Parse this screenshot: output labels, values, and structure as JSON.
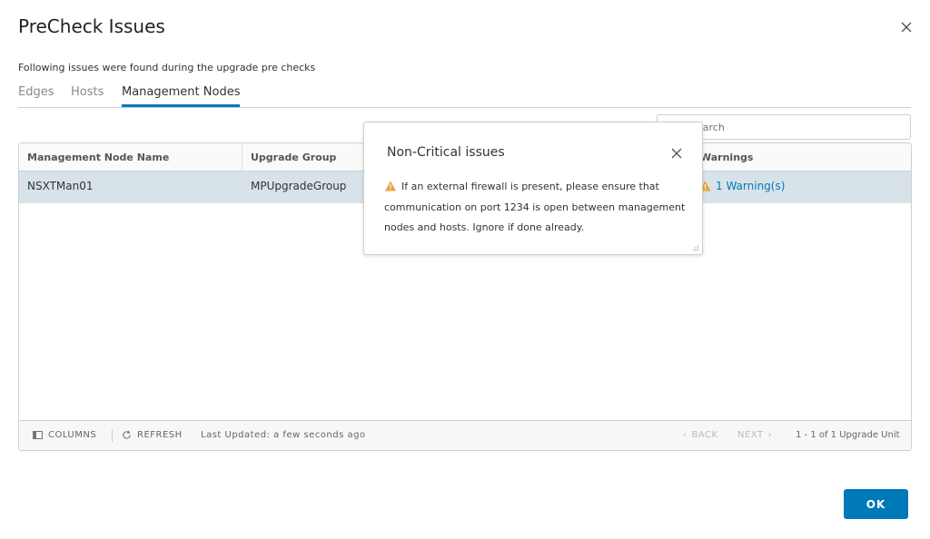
{
  "dialog": {
    "title": "PreCheck Issues",
    "subtitle": "Following issues were found during the upgrade pre checks",
    "ok_label": "OK"
  },
  "tabs": [
    {
      "label": "Edges",
      "active": false
    },
    {
      "label": "Hosts",
      "active": false
    },
    {
      "label": "Management Nodes",
      "active": true
    }
  ],
  "search": {
    "placeholder": "Search",
    "visible_fragment": "ch"
  },
  "grid": {
    "columns": [
      "Management Node Name",
      "Upgrade Group",
      "Warnings"
    ],
    "rows": [
      {
        "name": "NSXTMan01",
        "group": "MPUpgradeGroup",
        "warnings": "1 Warning(s)"
      }
    ],
    "footer": {
      "columns_label": "COLUMNS",
      "refresh_label": "REFRESH",
      "last_updated": "Last Updated: a few seconds ago",
      "back_label": "BACK",
      "next_label": "NEXT",
      "pagination": "1 - 1 of 1 Upgrade Unit"
    }
  },
  "popover": {
    "title": "Non-Critical issues",
    "message": "If an external firewall is present, please ensure that communication on port 1234 is open between management nodes and hosts. Ignore if done already."
  },
  "colors": {
    "accent": "#0079b8",
    "warning": "#e8a33d",
    "selected_row": "#d8e3e9"
  }
}
